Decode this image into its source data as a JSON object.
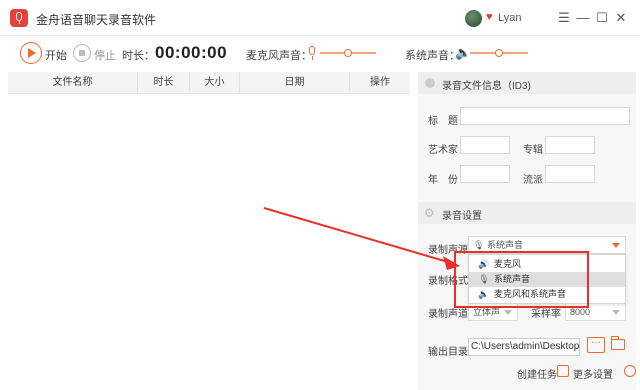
{
  "window": {
    "title": "金舟语音聊天录音软件",
    "username": "Lyan",
    "min_glyph": "—",
    "max_glyph": "☐",
    "close_glyph": "✕",
    "menu_glyph": "☰"
  },
  "toolbar": {
    "start_label": "开始",
    "stop_label": "停止",
    "duration_label": "时长：",
    "timer": "00:00:00",
    "mic_volume_label": "麦克风声音：",
    "system_volume_label": "系统声音：",
    "mic_volume_level": 0.5,
    "system_volume_level": 0.5
  },
  "table": {
    "columns": [
      "文件名称",
      "时长",
      "大小",
      "日期",
      "操作"
    ]
  },
  "id3": {
    "section_title": "录音文件信息（ID3)",
    "title_label": "标　题",
    "artist_label": "艺术家",
    "album_label": "专辑",
    "year_label": "年　份",
    "genre_label": "流派"
  },
  "settings": {
    "section_title": "录音设置",
    "source_label": "录制声源",
    "source_value": "系统声音",
    "format_label": "录制格式",
    "channel_label": "录制声道",
    "channel_value": "立体声",
    "samplerate_label": "采样率",
    "samplerate_value": "8000",
    "output_label": "输出目录",
    "output_path": "C:\\Users\\admin\\Desktop\\录",
    "browse_glyph": "···"
  },
  "dropdown": {
    "items": [
      {
        "icon": "microphone-wave-icon",
        "glyph": "🔊",
        "label": "麦克风"
      },
      {
        "icon": "microphone-icon",
        "glyph": "🎙",
        "label": "系统声音"
      },
      {
        "icon": "speaker-icon",
        "glyph": "🔈",
        "label": "麦克风和系统声音"
      }
    ],
    "selected_index": 1
  },
  "footer": {
    "create_task_label": "创建任务",
    "more_settings_label": "更多设置"
  },
  "colors": {
    "accent": "#f06a2d",
    "logo": "#e8403a",
    "annotation": "#e8302a"
  }
}
